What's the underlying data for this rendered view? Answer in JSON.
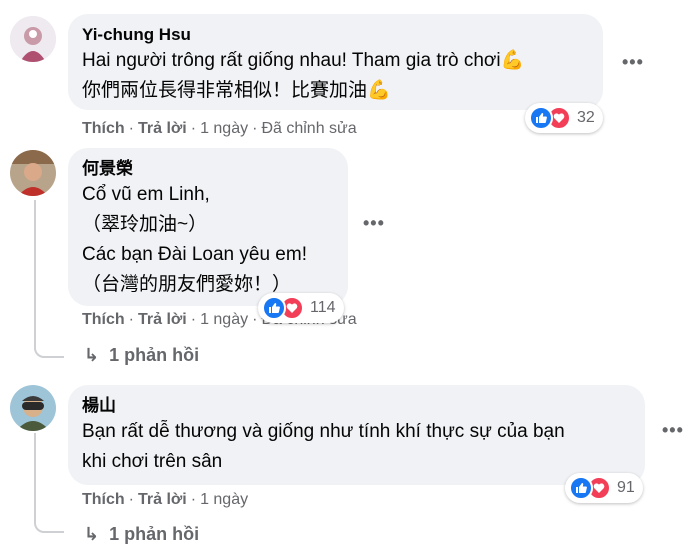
{
  "comments": [
    {
      "author": "Yi-chung Hsu",
      "lines": [
        "Hai người trông rất giống nhau! Tham gia trò chơi💪",
        "你們兩位長得非常相似！比賽加油💪"
      ],
      "actions": {
        "like": "Thích",
        "reply": "Trả lời",
        "time": "1 ngày",
        "edited": "Đã chỉnh sửa"
      },
      "reaction_count": "32",
      "more": "•••"
    },
    {
      "author": "何景榮",
      "lines": [
        "Cổ vũ em Linh,",
        "（翠玲加油~）",
        "Các bạn Đài Loan yêu em!",
        "（台灣的朋友們愛妳！）"
      ],
      "actions": {
        "like": "Thích",
        "reply": "Trả lời",
        "time": "1 ngày",
        "edited": "Đã chỉnh sửa"
      },
      "reaction_count": "114",
      "replies": "1 phản hồi",
      "more": "•••"
    },
    {
      "author": "楊山",
      "lines": [
        "Bạn rất dễ thương và giống như tính khí thực sự của bạn",
        "khi chơi trên sân"
      ],
      "actions": {
        "like": "Thích",
        "reply": "Trả lời",
        "time": "1 ngày"
      },
      "reaction_count": "91",
      "replies": "1 phản hồi",
      "more": "•••"
    }
  ],
  "colors": {
    "bubble": "#f0f2f5",
    "meta": "#65676b",
    "like": "#1877f2",
    "love": "#f33e58"
  },
  "icons": {
    "like": "thumbs-up-icon",
    "love": "heart-icon",
    "reply": "reply-arrow-icon"
  }
}
